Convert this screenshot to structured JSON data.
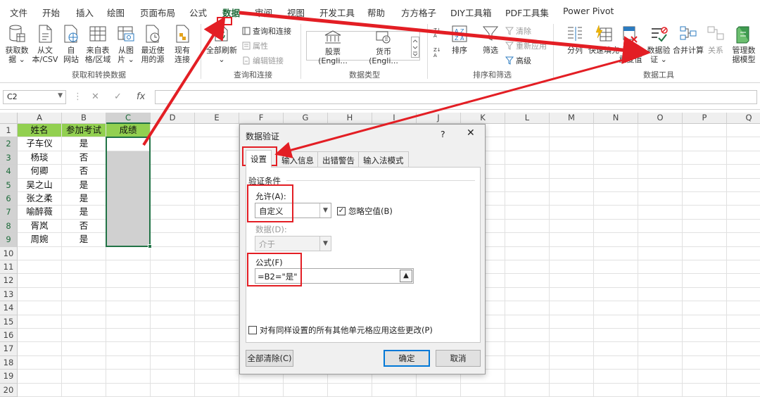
{
  "tabs": [
    "文件",
    "开始",
    "插入",
    "绘图",
    "页面布局",
    "公式",
    "数据",
    "审阅",
    "视图",
    "开发工具",
    "帮助",
    "方方格子",
    "DIY工具箱",
    "PDF工具集",
    "Power Pivot"
  ],
  "active_tab": "数据",
  "ribbon": {
    "get_data": [
      "获取数",
      "据 ⌄"
    ],
    "from_csv": [
      "从文",
      "本/CSV"
    ],
    "from_web": [
      "自",
      "网站"
    ],
    "from_table": [
      "来自表",
      "格/区域"
    ],
    "from_picture": [
      "从图",
      "片 ⌄"
    ],
    "recent_sources": [
      "最近使",
      "用的源"
    ],
    "existing_conn": [
      "现有",
      "连接"
    ],
    "group_get": "获取和转换数据",
    "refresh_all": [
      "全部刷新",
      "⌄"
    ],
    "queries_conn": "查询和连接",
    "properties": "属性",
    "edit_links": "编辑链接",
    "group_queries": "查询和连接",
    "stocks": "股票 (Engli...",
    "currency": "货币 (Engli...",
    "group_datatypes": "数据类型",
    "sort": "排序",
    "filter": "筛选",
    "clear": "清除",
    "reapply": "重新应用",
    "advanced": "高级",
    "group_sort": "排序和筛选",
    "text_to_cols": "分列",
    "flash_fill": "快速填充",
    "remove_dup": [
      "删除",
      "重复值"
    ],
    "data_validation": [
      "数据验",
      "证 ⌄"
    ],
    "consolidate": "合并计算",
    "relations": "关系",
    "data_model": [
      "管理数",
      "据模型"
    ],
    "group_tools": "数据工具"
  },
  "formula_bar": {
    "name_box": "C2",
    "cancel": "✕",
    "enter": "✓",
    "fx": "fx",
    "formula": ""
  },
  "sheet": {
    "columns": [
      "A",
      "B",
      "C",
      "D",
      "E",
      "F",
      "G",
      "H",
      "I",
      "J",
      "K",
      "L",
      "M",
      "N",
      "O",
      "P",
      "Q"
    ],
    "rows": [
      "1",
      "2",
      "3",
      "4",
      "5",
      "6",
      "7",
      "8",
      "9",
      "10",
      "11",
      "12",
      "13",
      "14",
      "15",
      "16",
      "17",
      "18",
      "19",
      "20"
    ],
    "headers": [
      "姓名",
      "参加考试",
      "成绩"
    ],
    "data": [
      [
        "子车仪",
        "是"
      ],
      [
        "杨琰",
        "否"
      ],
      [
        "何卿",
        "否"
      ],
      [
        "吴之山",
        "是"
      ],
      [
        "张之柔",
        "是"
      ],
      [
        "喻醉薇",
        "是"
      ],
      [
        "胥岚",
        "否"
      ],
      [
        "周婉",
        "是"
      ]
    ],
    "header_color": "#92d050"
  },
  "dialog": {
    "title": "数据验证",
    "help": "?",
    "close": "✕",
    "tabs": [
      "设置",
      "输入信息",
      "出错警告",
      "输入法模式"
    ],
    "section": "验证条件",
    "allow_label": "允许(A):",
    "allow_value": "自定义",
    "ignore_blank": "忽略空值(B)",
    "ignore_blank_checked": true,
    "data_label": "数据(D):",
    "data_value": "介于",
    "formula_label": "公式(F)",
    "formula_value": "=B2=\"是\"",
    "apply_all": "对有同样设置的所有其他单元格应用这些更改(P)",
    "clear_all": "全部清除(C)",
    "ok": "确定",
    "cancel": "取消"
  },
  "colors": {
    "accent": "#217346",
    "annotation": "#e31e24"
  }
}
